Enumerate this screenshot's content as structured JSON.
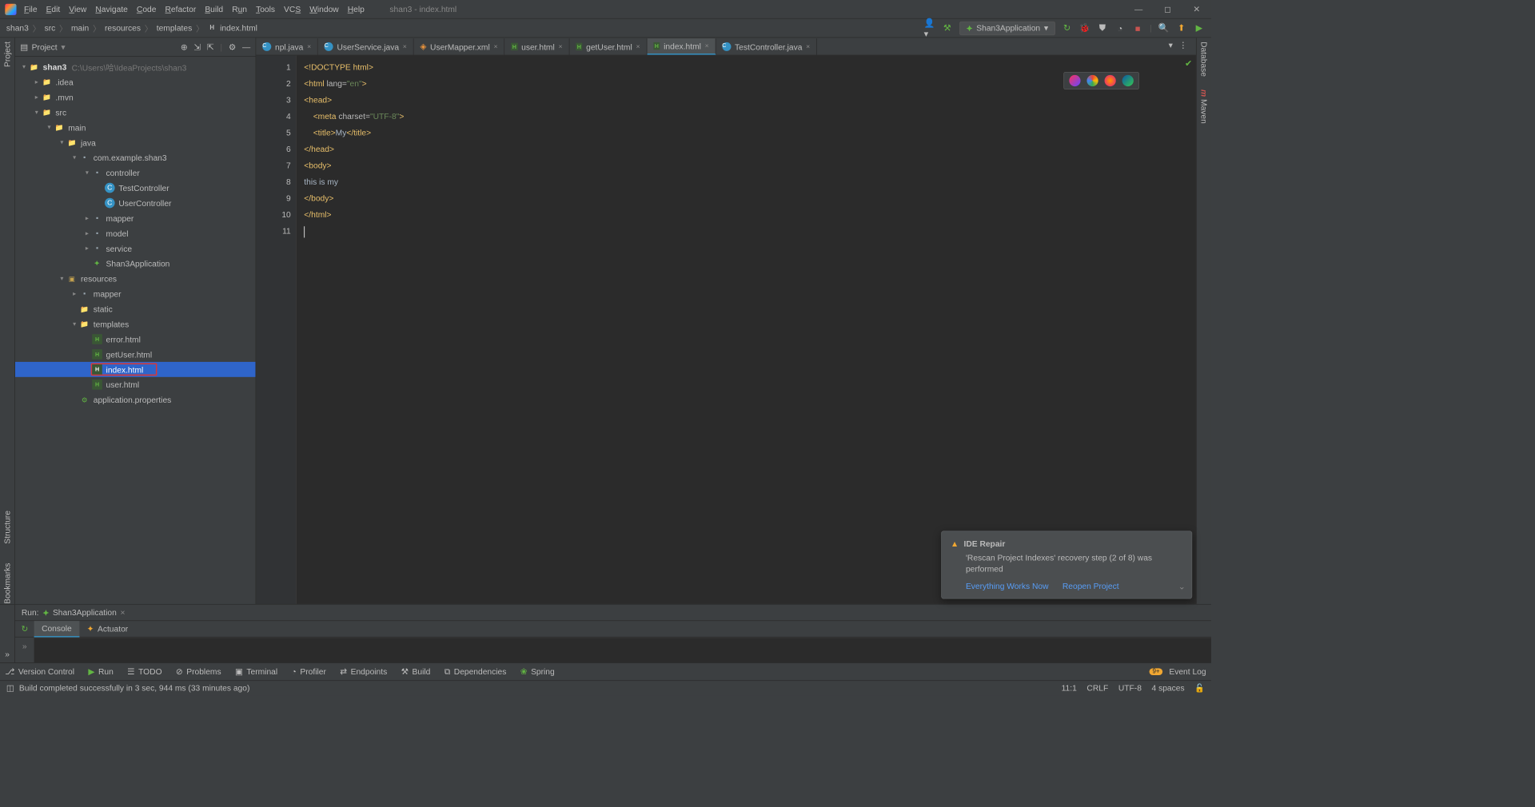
{
  "window": {
    "title": "shan3 - index.html"
  },
  "menu": [
    "File",
    "Edit",
    "View",
    "Navigate",
    "Code",
    "Refactor",
    "Build",
    "Run",
    "Tools",
    "VCS",
    "Window",
    "Help"
  ],
  "breadcrumbs": [
    "shan3",
    "src",
    "main",
    "resources",
    "templates",
    "index.html"
  ],
  "run_config": "Shan3Application",
  "project_label": "Project",
  "project_root": {
    "name": "shan3",
    "path": "C:\\Users\\哈\\IdeaProjects\\shan3"
  },
  "tree": [
    {
      "d": 1,
      "a": "▸",
      "ic": "folder",
      "t": ".idea"
    },
    {
      "d": 1,
      "a": "▸",
      "ic": "folder",
      "t": ".mvn"
    },
    {
      "d": 1,
      "a": "▾",
      "ic": "folder",
      "t": "src"
    },
    {
      "d": 2,
      "a": "▾",
      "ic": "folder",
      "t": "main"
    },
    {
      "d": 3,
      "a": "▾",
      "ic": "folder",
      "t": "java"
    },
    {
      "d": 4,
      "a": "▾",
      "ic": "pkg",
      "t": "com.example.shan3"
    },
    {
      "d": 5,
      "a": "▾",
      "ic": "pkg",
      "t": "controller"
    },
    {
      "d": 6,
      "a": "",
      "ic": "java",
      "t": "TestController"
    },
    {
      "d": 6,
      "a": "",
      "ic": "java",
      "t": "UserController"
    },
    {
      "d": 5,
      "a": "▸",
      "ic": "pkg",
      "t": "mapper"
    },
    {
      "d": 5,
      "a": "▸",
      "ic": "pkg",
      "t": "model"
    },
    {
      "d": 5,
      "a": "▸",
      "ic": "pkg",
      "t": "service"
    },
    {
      "d": 5,
      "a": "",
      "ic": "spring",
      "t": "Shan3Application"
    },
    {
      "d": 3,
      "a": "▾",
      "ic": "res",
      "t": "resources"
    },
    {
      "d": 4,
      "a": "▸",
      "ic": "pkg",
      "t": "mapper"
    },
    {
      "d": 4,
      "a": "",
      "ic": "folder",
      "t": "static"
    },
    {
      "d": 4,
      "a": "▾",
      "ic": "folder",
      "t": "templates"
    },
    {
      "d": 5,
      "a": "",
      "ic": "html",
      "t": "error.html"
    },
    {
      "d": 5,
      "a": "",
      "ic": "html",
      "t": "getUser.html"
    },
    {
      "d": 5,
      "a": "",
      "ic": "html",
      "t": "index.html",
      "sel": true,
      "hl": true
    },
    {
      "d": 5,
      "a": "",
      "ic": "html",
      "t": "user.html"
    },
    {
      "d": 4,
      "a": "",
      "ic": "prop",
      "t": "application.properties"
    }
  ],
  "tabs": [
    {
      "t": "npl.java",
      "ic": "java"
    },
    {
      "t": "UserService.java",
      "ic": "java"
    },
    {
      "t": "UserMapper.xml",
      "ic": "xml"
    },
    {
      "t": "user.html",
      "ic": "html"
    },
    {
      "t": "getUser.html",
      "ic": "html"
    },
    {
      "t": "index.html",
      "ic": "html",
      "active": true
    },
    {
      "t": "TestController.java",
      "ic": "java"
    }
  ],
  "code_lines": [
    "1",
    "2",
    "3",
    "4",
    "5",
    "6",
    "7",
    "8",
    "9",
    "10",
    "11"
  ],
  "code": {
    "l1": "<!DOCTYPE html>",
    "l2a": "<html ",
    "l2b": "lang=",
    "l2c": "\"en\"",
    "l2d": ">",
    "l3": "<head>",
    "l4a": "    <meta ",
    "l4b": "charset=",
    "l4c": "\"UTF-8\"",
    "l4d": ">",
    "l5a": "    <title>",
    "l5b": "My",
    "l5c": "</title>",
    "l6": "</head>",
    "l7": "<body>",
    "l8": "this is my",
    "l9": "</body>",
    "l10": "</html>"
  },
  "run": {
    "label": "Run:",
    "name": "Shan3Application",
    "tab1": "Console",
    "tab2": "Actuator"
  },
  "tools": [
    "Version Control",
    "Run",
    "TODO",
    "Problems",
    "Terminal",
    "Profiler",
    "Endpoints",
    "Build",
    "Dependencies",
    "Spring"
  ],
  "event_log": "Event Log",
  "status": {
    "msg": "Build completed successfully in 3 sec, 944 ms (33 minutes ago)",
    "pos": "11:1",
    "eol": "CRLF",
    "enc": "UTF-8",
    "indent": "4 spaces"
  },
  "notif": {
    "title": "IDE Repair",
    "msg": "'Rescan Project Indexes' recovery step (2 of 8) was performed",
    "b1": "Everything Works Now",
    "b2": "Reopen Project"
  },
  "side": {
    "project": "Project",
    "structure": "Structure",
    "bookmarks": "Bookmarks",
    "database": "Database",
    "maven": "Maven"
  }
}
